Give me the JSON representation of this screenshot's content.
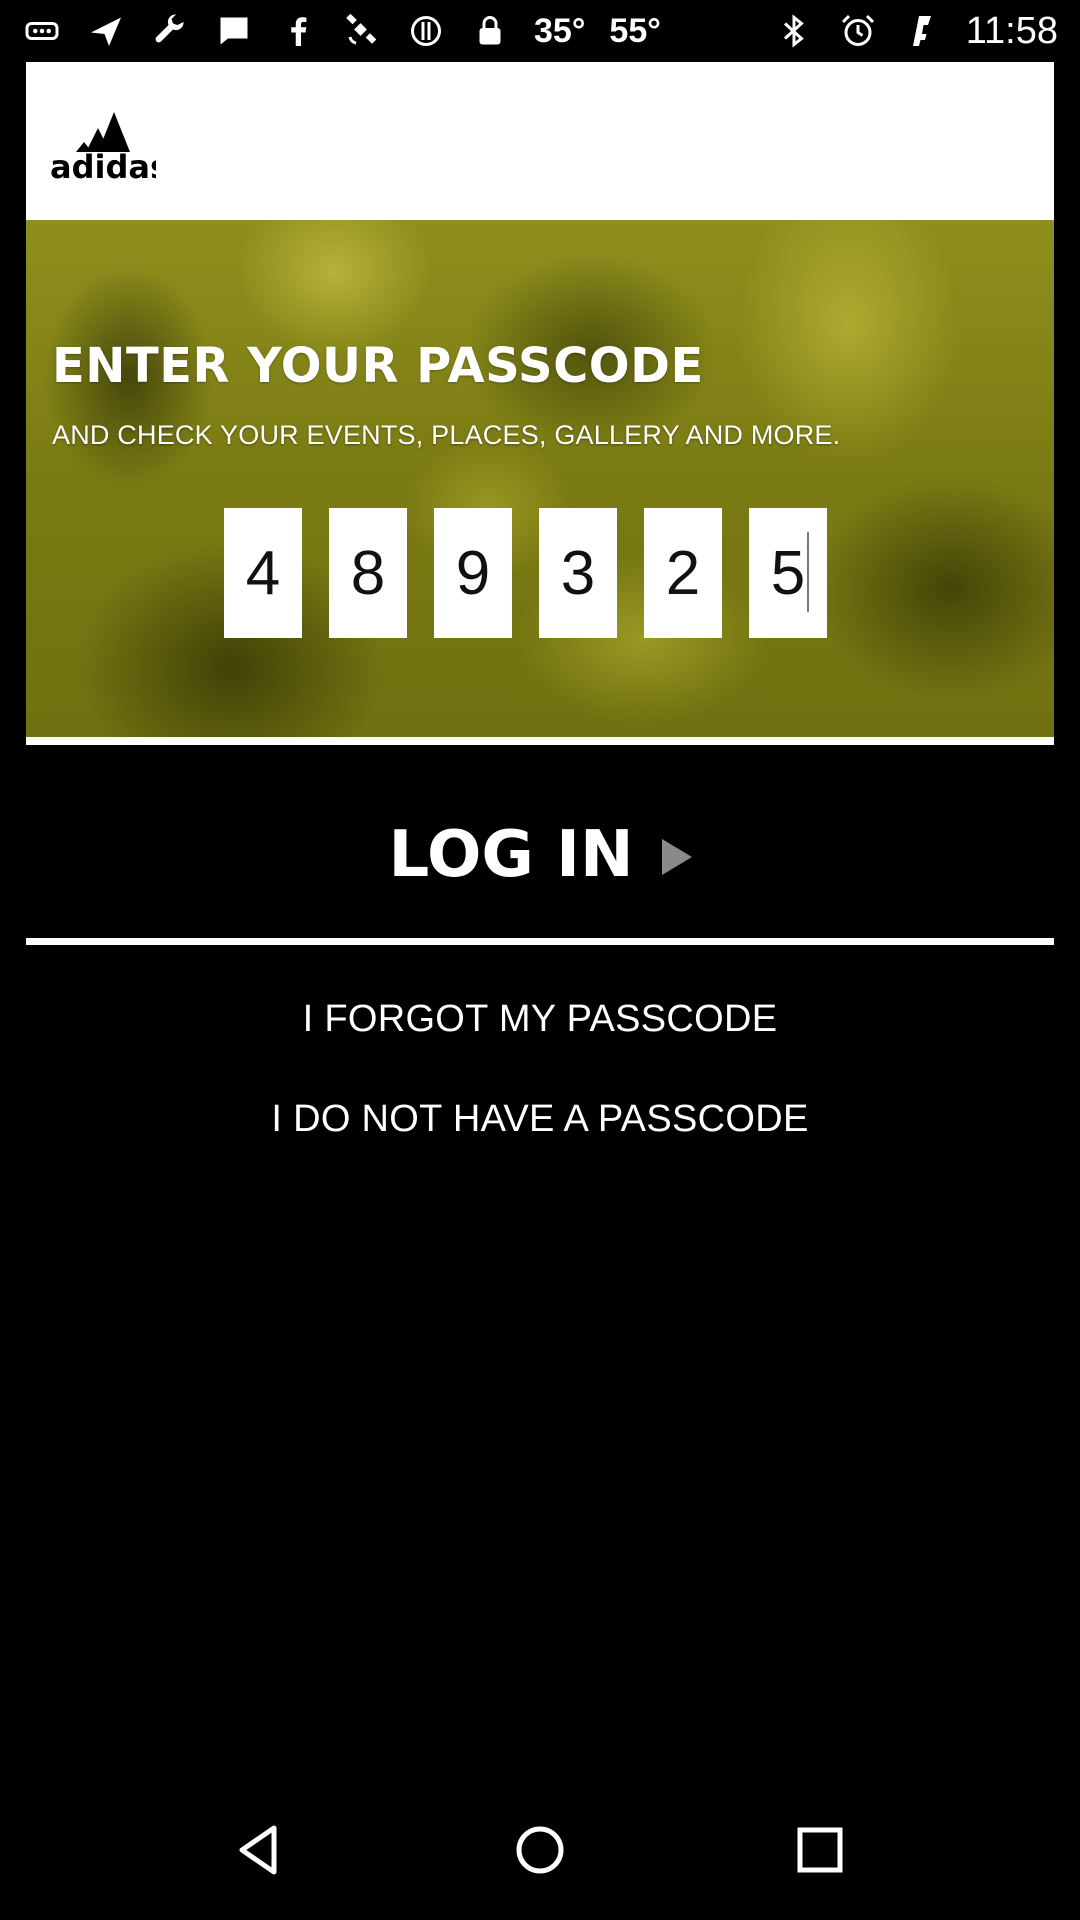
{
  "status_bar": {
    "left_icons": [
      "more-icon",
      "send-icon",
      "wrench-icon",
      "message-icon",
      "facebook-icon",
      "satellite-icon",
      "block-icon",
      "lock-icon"
    ],
    "temp1": "35°",
    "temp2": "55°",
    "right_icons": [
      "bluetooth-icon",
      "alarm-icon",
      "signal-icon"
    ],
    "time": "11:58"
  },
  "header": {
    "logo_text": "adidas"
  },
  "hero": {
    "title": "ENTER YOUR PASSCODE",
    "subtitle": "AND CHECK YOUR EVENTS, PLACES, GALLERY AND MORE.",
    "digits": [
      "4",
      "8",
      "9",
      "3",
      "2",
      "5"
    ]
  },
  "login": {
    "label": "LOG IN"
  },
  "links": {
    "forgot": "I FORGOT MY PASSCODE",
    "no_passcode": "I DO NOT HAVE A PASSCODE"
  },
  "nav": {
    "back": "back-icon",
    "home": "home-icon",
    "recents": "recents-icon"
  }
}
